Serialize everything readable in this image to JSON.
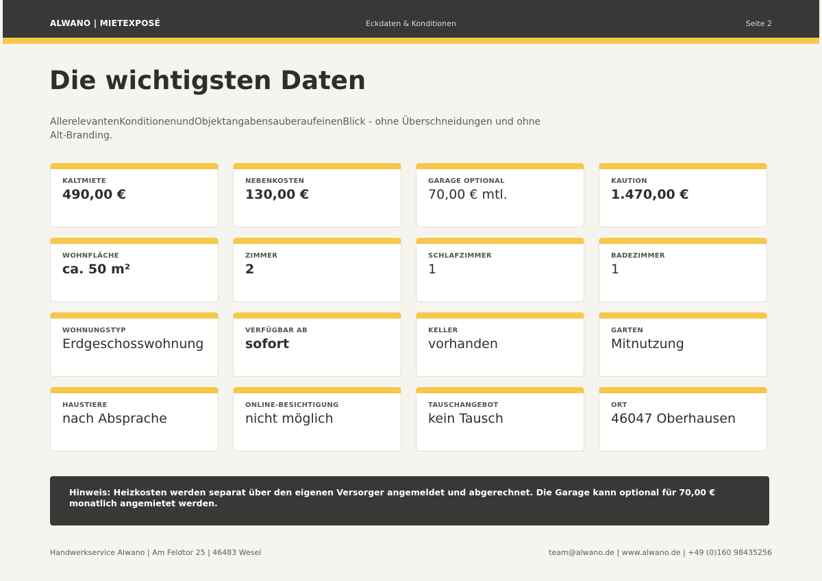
{
  "header": {
    "brand": "ALWANO | MIETEXPOSÉ",
    "section": "Eckdaten & Konditionen",
    "page": "Seite 2"
  },
  "colors": {
    "accent": "#f5c84c",
    "dark": "#383936",
    "background": "#f6f4ef"
  },
  "main": {
    "title": "Die wichtigsten Daten",
    "intro": "AllerelevantenKonditionenundObjektangabensauberaufeinenBlick - ohne Überschneidungen und ohne Alt-Branding."
  },
  "cards": [
    {
      "label": "KALTMIETE",
      "value": "490,00 €",
      "bold": true
    },
    {
      "label": "NEBENKOSTEN",
      "value": "130,00 €",
      "bold": true
    },
    {
      "label": "GARAGE OPTIONAL",
      "value": "70,00 € mtl.",
      "bold": false
    },
    {
      "label": "KAUTION",
      "value": "1.470,00 €",
      "bold": true
    },
    {
      "label": "WOHNFLÄCHE",
      "value": "ca. 50 m²",
      "bold": true
    },
    {
      "label": "ZIMMER",
      "value": "2",
      "bold": true
    },
    {
      "label": "SCHLAFZIMMER",
      "value": "1",
      "bold": false
    },
    {
      "label": "BADEZIMMER",
      "value": "1",
      "bold": false
    },
    {
      "label": "WOHNUNGSTYP",
      "value": "Erdgeschosswohnung",
      "bold": false
    },
    {
      "label": "VERFÜGBAR AB",
      "value": "sofort",
      "bold": true
    },
    {
      "label": "KELLER",
      "value": "vorhanden",
      "bold": false
    },
    {
      "label": "GARTEN",
      "value": "Mitnutzung",
      "bold": false
    },
    {
      "label": "HAUSTIERE",
      "value": "nach Absprache",
      "bold": false
    },
    {
      "label": "ONLINE-BESICHTIGUNG",
      "value": "nicht möglich",
      "bold": false
    },
    {
      "label": "TAUSCHANGEBOT",
      "value": "kein Tausch",
      "bold": false
    },
    {
      "label": "ORT",
      "value": "46047 Oberhausen",
      "bold": false
    }
  ],
  "note": {
    "text": "Hinweis: Heizkosten werden separat über den eigenen Versorger angemeldet und abgerechnet. Die Garage kann optional für 70,00 € monatlich angemietet werden."
  },
  "footer": {
    "left": "Handwerkservice Alwano | Am Feldtor 25 | 46483 Wesel",
    "right": "team@alwano.de | www.alwano.de | +49 (0)160 98435256"
  }
}
